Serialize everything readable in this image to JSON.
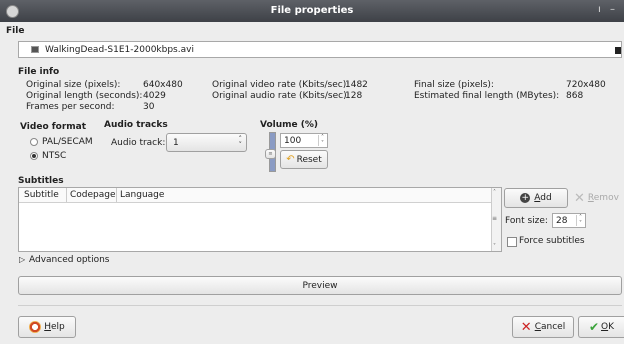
{
  "window": {
    "title": "File properties",
    "controls": [
      "ı",
      "–"
    ]
  },
  "file": {
    "section_label": "File",
    "filename": "WalkingDead-S1E1-2000kbps.avi"
  },
  "file_info": {
    "section_label": "File info",
    "orig_size_label": "Original size (pixels):",
    "orig_size_value": "640x480",
    "orig_length_label": "Original length (seconds):",
    "orig_length_value": "4029",
    "fps_label": "Frames per second:",
    "fps_value": "30",
    "video_rate_label": "Original video rate (Kbits/sec):",
    "video_rate_value": "1482",
    "audio_rate_label": "Original audio rate (Kbits/sec):",
    "audio_rate_value": "128",
    "final_size_label": "Final size (pixels):",
    "final_size_value": "720x480",
    "final_length_label": "Estimated final length (MBytes):",
    "final_length_value": "868"
  },
  "video_format": {
    "label": "Video format",
    "options": [
      "PAL/SECAM",
      "NTSC"
    ],
    "selected": "NTSC"
  },
  "audio_tracks": {
    "label": "Audio tracks",
    "track_label": "Audio track:",
    "track_value": "1"
  },
  "volume": {
    "label": "Volume (%)",
    "value": "100",
    "reset_label": "Reset",
    "level": 1.0
  },
  "subtitles": {
    "label": "Subtitles",
    "columns": [
      "Subtitle",
      "Codepage",
      "Language"
    ],
    "add_label": "Add",
    "remove_label": "Remov",
    "font_size_label": "Font size:",
    "font_size_value": "28",
    "force_label": "Force subtitles"
  },
  "advanced": {
    "label": "Advanced options"
  },
  "preview": {
    "label": "Preview"
  },
  "buttons": {
    "help": "Help",
    "cancel": "Cancel",
    "ok": "OK"
  },
  "colors": {
    "titlebar": "#4a4d53",
    "background": "#ededed",
    "cancel_icon": "#cc2222",
    "ok_icon": "#3aa33a"
  }
}
